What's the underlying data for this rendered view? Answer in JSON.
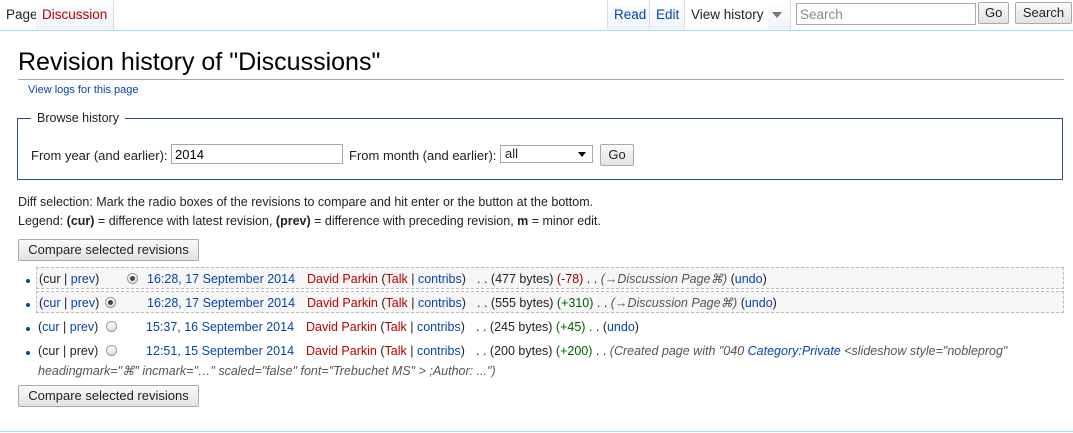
{
  "tabs": {
    "page": "Page",
    "discussion": "Discussion",
    "read": "Read",
    "edit": "Edit",
    "view_history": "View history"
  },
  "search": {
    "placeholder": "Search",
    "go": "Go",
    "search": "Search"
  },
  "title": "Revision history of \"Discussions\"",
  "view_logs": "View logs for this page",
  "browse": {
    "legend": "Browse history",
    "year_label": "From year (and earlier):",
    "year_value": "2014",
    "month_label": "From month (and earlier):",
    "month_value": "all",
    "go": "Go"
  },
  "diff_help": "Diff selection: Mark the radio boxes of the revisions to compare and hit enter or the button at the bottom.",
  "legend": {
    "prefix": "Legend: ",
    "cur": "(cur)",
    "cur_text": " = difference with latest revision, ",
    "prev": "(prev)",
    "prev_text": " = difference with preceding revision, ",
    "m": "m",
    "m_text": " = minor edit."
  },
  "compare_button": "Compare selected revisions",
  "revisions": [
    {
      "cur": "cur",
      "prev": "prev",
      "timestamp": "16:28, 17 September 2014",
      "user": "David Parkin",
      "talk": "Talk",
      "contribs": "contribs",
      "bytes": "(477 bytes)",
      "delta": "(-78)",
      "summary": "(→Discussion Page⌘)",
      "undo": "undo"
    },
    {
      "cur": "cur",
      "prev": "prev",
      "timestamp": "16:28, 17 September 2014",
      "user": "David Parkin",
      "talk": "Talk",
      "contribs": "contribs",
      "bytes": "(555 bytes)",
      "delta": "(+310)",
      "summary": "(→Discussion Page⌘)",
      "undo": "undo"
    },
    {
      "cur": "cur",
      "prev": "prev",
      "timestamp": "15:37, 16 September 2014",
      "user": "David Parkin",
      "talk": "Talk",
      "contribs": "contribs",
      "bytes": "(245 bytes)",
      "delta": "(+45)",
      "undo": "undo"
    },
    {
      "cur": "cur",
      "prev": "prev",
      "timestamp": "12:51, 15 September 2014",
      "user": "David Parkin",
      "talk": "Talk",
      "contribs": "contribs",
      "bytes": "(200 bytes)",
      "delta": "(+200)",
      "summary_a": "(Created page with \"040 ",
      "summary_link": "Category:Private",
      "summary_b": " <slideshow style=\"nobleprog\"",
      "summary_line2": "headingmark=\"⌘\" incmark=\"…\" scaled=\"false\" font=\"Trebuchet MS\" > ;Author: ...\")"
    }
  ]
}
